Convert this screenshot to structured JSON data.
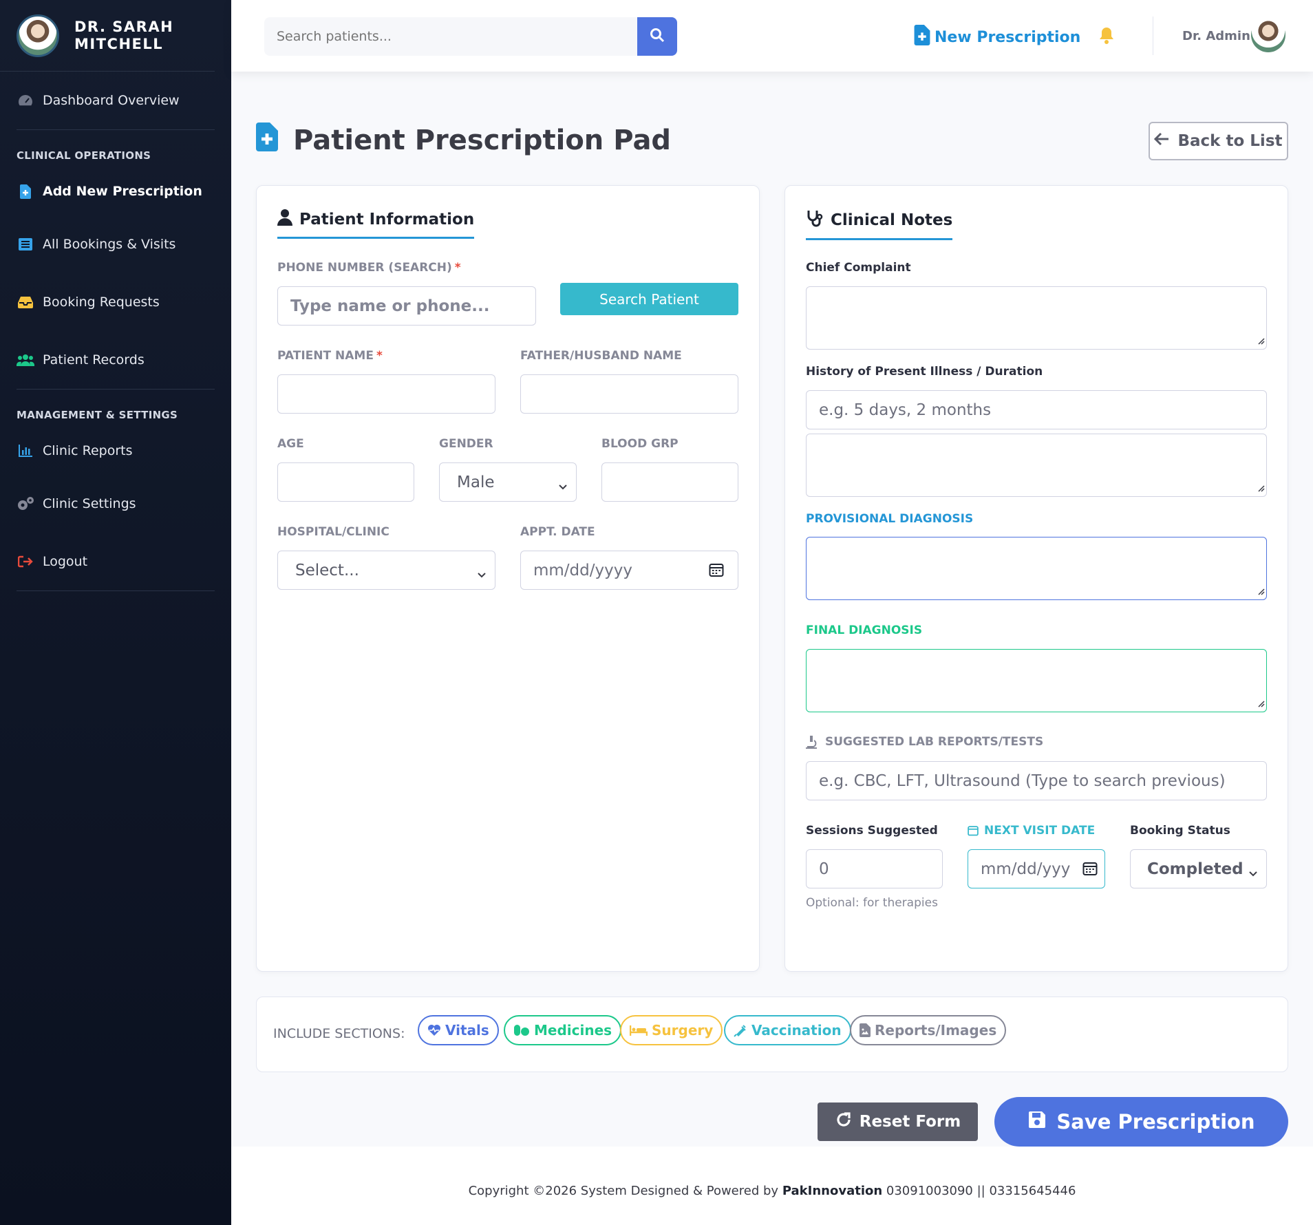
{
  "sidebar": {
    "doctor_name": "DR. SARAH MITCHELL",
    "items": [
      {
        "label": "Dashboard Overview",
        "icon": "tachometer-icon"
      },
      {
        "label": "Add New Prescription",
        "icon": "file-medical-icon"
      },
      {
        "label": "All Bookings & Visits",
        "icon": "list-icon"
      },
      {
        "label": "Booking Requests",
        "icon": "inbox-icon"
      },
      {
        "label": "Patient Records",
        "icon": "users-icon"
      },
      {
        "label": "Clinic Reports",
        "icon": "chart-bar-icon"
      },
      {
        "label": "Clinic Settings",
        "icon": "cogs-icon"
      },
      {
        "label": "Logout",
        "icon": "sign-out-icon"
      }
    ],
    "heading_clinical": "CLINICAL OPERATIONS",
    "heading_management": "MANAGEMENT & SETTINGS"
  },
  "topbar": {
    "search_placeholder": "Search patients...",
    "new_prescription": "New Prescription",
    "user_name": "Dr. Admin"
  },
  "page": {
    "title": "Patient Prescription Pad",
    "back_label": "Back to List"
  },
  "patient": {
    "title": "Patient Information",
    "phone_label": "PHONE NUMBER (SEARCH)",
    "phone_placeholder": "Type name or phone...",
    "search_button": "Search Patient",
    "name_label": "PATIENT NAME",
    "father_label": "FATHER/HUSBAND NAME",
    "age_label": "AGE",
    "gender_label": "GENDER",
    "gender_value": "Male",
    "blood_label": "BLOOD GRP",
    "hospital_label": "HOSPITAL/CLINIC",
    "hospital_value": "Select...",
    "appt_label": "APPT. DATE",
    "appt_placeholder": "mm/dd/yyyy",
    "required_mark": "*"
  },
  "clinical": {
    "title": "Clinical Notes",
    "chief_label": "Chief Complaint",
    "history_label": "History of Present Illness / Duration",
    "history_placeholder": "e.g. 5 days, 2 months",
    "provisional_label": "PROVISIONAL DIAGNOSIS",
    "final_label": "FINAL DIAGNOSIS",
    "lab_label": "SUGGESTED LAB REPORTS/TESTS",
    "lab_placeholder": "e.g. CBC, LFT, Ultrasound (Type to search previous)",
    "sessions_label": "Sessions Suggested",
    "sessions_value": "0",
    "sessions_hint": "Optional: for therapies",
    "next_visit_label": "NEXT VISIT DATE",
    "next_visit_placeholder": "mm/dd/yyy",
    "status_label": "Booking Status",
    "status_value": "Completed"
  },
  "sections": {
    "label": "INCLUDE SECTIONS:",
    "pills": [
      {
        "label": "Vitals",
        "color": "#4e73df"
      },
      {
        "label": "Medicines",
        "color": "#1cc88a"
      },
      {
        "label": "Surgery",
        "color": "#f6c23e"
      },
      {
        "label": "Vaccination",
        "color": "#36b9cc"
      },
      {
        "label": "Reports/Images",
        "color": "#858796"
      }
    ]
  },
  "actions": {
    "reset": "Reset Form",
    "save": "Save Prescription"
  },
  "footer": {
    "prefix": "Copyright ©2026 System Designed & Powered by",
    "company": "PakInnovation",
    "contacts": "03091003090 || 03315645446"
  }
}
